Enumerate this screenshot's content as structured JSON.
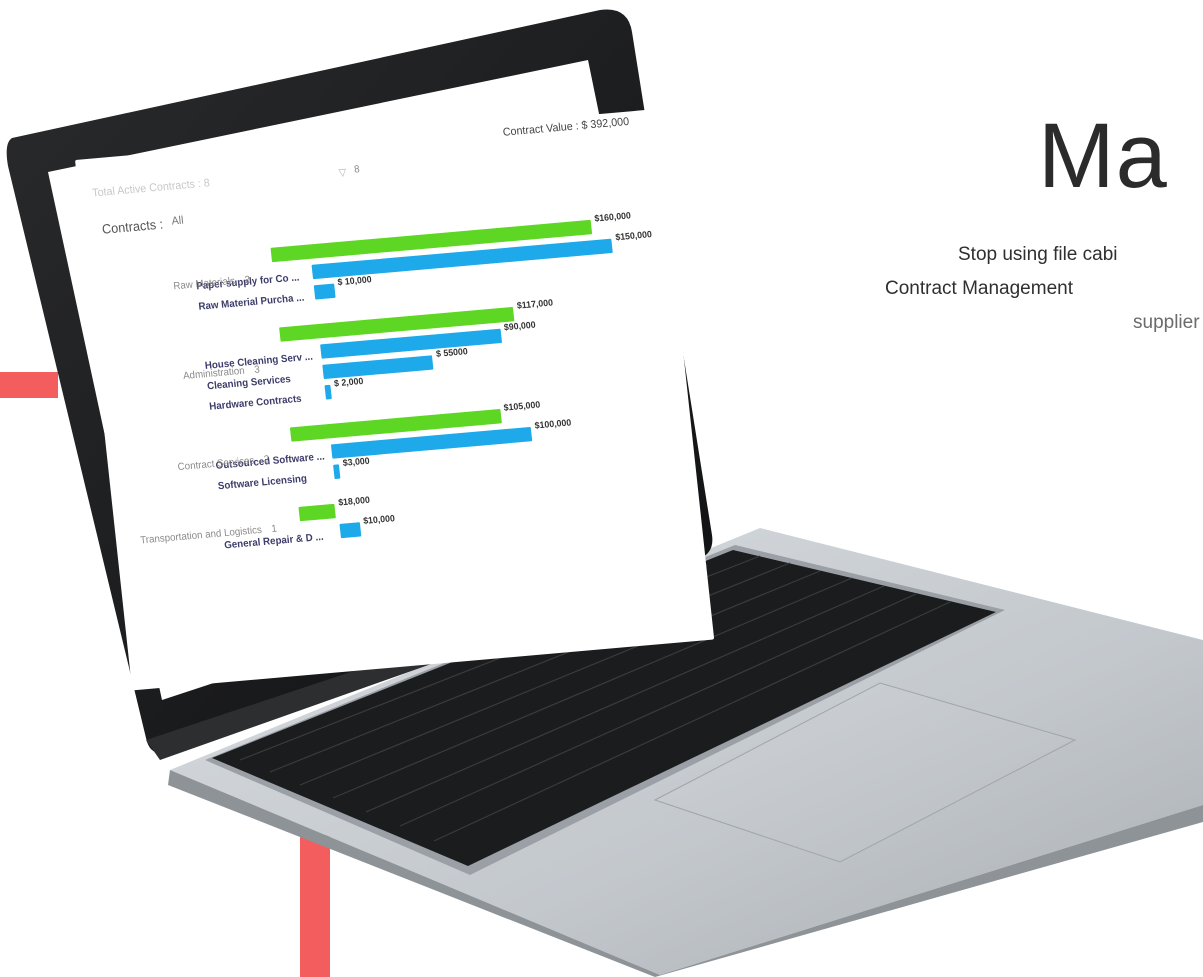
{
  "hero": {
    "title": "Ma",
    "line1": "Stop using file cabi",
    "line2": "Contract Management",
    "line3": "supplier"
  },
  "dashboard": {
    "total_active_label": "Total Active Contracts : 8",
    "filter_value": "8",
    "contract_value_label": "Contract Value : $ 392,000",
    "contracts_label": "Contracts :",
    "contracts_filter": "All",
    "categories": [
      {
        "name": "Raw Materials",
        "count": "2",
        "total_label": "$160,000",
        "total_value": 160000
      },
      {
        "name": "Administration",
        "count": "3",
        "total_label": "$117,000",
        "total_value": 117000
      },
      {
        "name": "Contract Services",
        "count": "2",
        "total_label": "$105,000",
        "total_value": 105000
      },
      {
        "name": "Transportation and Logistics",
        "count": "1",
        "total_label": "$18,000",
        "total_value": 18000
      }
    ],
    "items": [
      {
        "name": "Paper supply for Co ...",
        "label": "$150,000",
        "value": 150000
      },
      {
        "name": "Raw Material Purcha ...",
        "label": "$ 10,000",
        "value": 10000
      },
      {
        "name": "House Cleaning Serv ...",
        "label": "$90,000",
        "value": 90000
      },
      {
        "name": "Cleaning Services",
        "label": "$ 55000",
        "value": 55000
      },
      {
        "name": "Hardware Contracts",
        "label": "$ 2,000",
        "value": 2000
      },
      {
        "name": "Outsourced Software ...",
        "label": "$100,000",
        "value": 100000
      },
      {
        "name": "Software Licensing",
        "label": "$3,000",
        "value": 3000
      },
      {
        "name": "General Repair & D ...",
        "label": "$10,000",
        "value": 10000
      }
    ]
  },
  "colors": {
    "accent": "#f45d5d",
    "category_bar": "#5ed624",
    "item_bar": "#1ea9ea"
  }
}
